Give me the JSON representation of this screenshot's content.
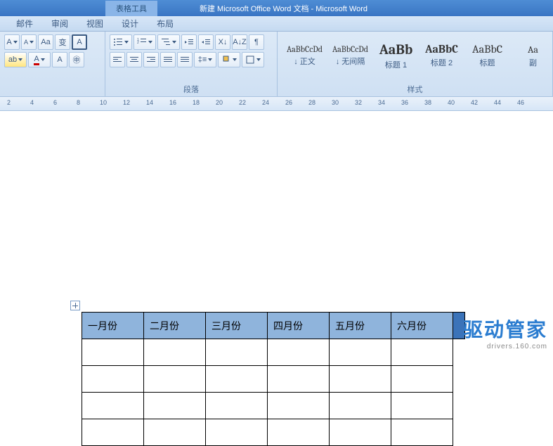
{
  "title_bar": {
    "tab_group": "表格工具",
    "doc_title": "新建 Microsoft Office Word 文档 - Microsoft Word"
  },
  "menu": {
    "items": [
      "邮件",
      "审阅",
      "视图",
      "设计",
      "布局"
    ]
  },
  "ribbon": {
    "paragraph_label": "段落",
    "styles_label": "样式",
    "styles": [
      {
        "sample": "AaBbCcDd",
        "name": "↓ 正文",
        "size": "12px"
      },
      {
        "sample": "AaBbCcDd",
        "name": "↓ 无间隔",
        "size": "12px"
      },
      {
        "sample": "AaBb",
        "name": "标题 1",
        "size": "20px",
        "bold": true
      },
      {
        "sample": "AaBbC",
        "name": "标题 2",
        "size": "16px",
        "bold": true
      },
      {
        "sample": "AaBbC",
        "name": "标题",
        "size": "16px"
      },
      {
        "sample": "Aa",
        "name": "副",
        "size": "14px"
      }
    ]
  },
  "ruler": {
    "marks": [
      2,
      4,
      6,
      8,
      10,
      12,
      14,
      16,
      18,
      20,
      22,
      24,
      26,
      28,
      30,
      32,
      34,
      36,
      38,
      40,
      42,
      44,
      46
    ]
  },
  "table": {
    "headers": [
      "一月份",
      "二月份",
      "三月份",
      "四月份",
      "五月份",
      "六月份"
    ],
    "rows": 4
  },
  "watermark": {
    "main": "驱动管家",
    "sub": "drivers.160.com"
  }
}
